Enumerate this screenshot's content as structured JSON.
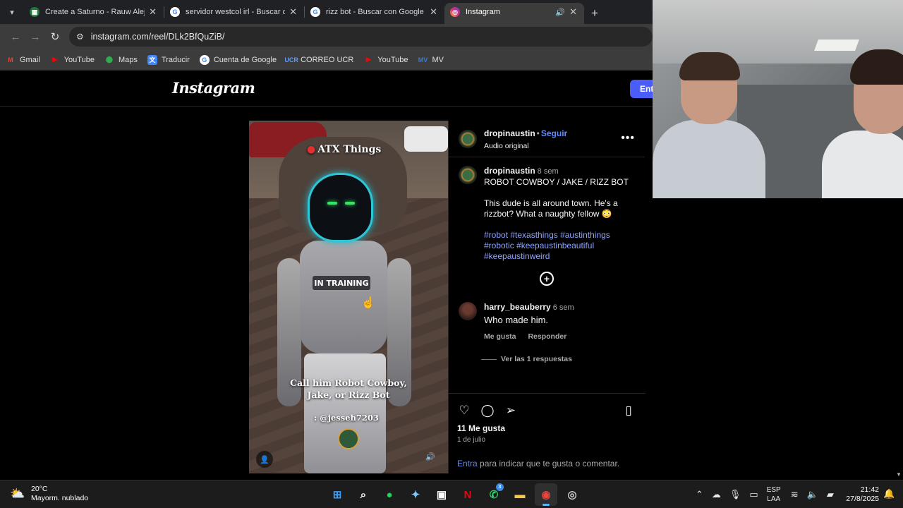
{
  "browser": {
    "tabs": [
      {
        "title": "Create a Saturno - Rauw Alejan",
        "favicon": "sheet-icon",
        "active": false
      },
      {
        "title": "servidor westcol irl - Buscar con",
        "favicon": "google-icon",
        "active": false
      },
      {
        "title": "rizz bot - Buscar con Google",
        "favicon": "google-icon",
        "active": false
      },
      {
        "title": "Instagram",
        "favicon": "instagram-icon",
        "active": true
      }
    ],
    "url": "instagram.com/reel/DLk2BfQuZiB/",
    "bookmarks": [
      {
        "label": "Gmail",
        "icon": "gmail-icon",
        "color": "#ea4335"
      },
      {
        "label": "YouTube",
        "icon": "youtube-icon",
        "color": "#ff0000"
      },
      {
        "label": "Maps",
        "icon": "maps-icon",
        "color": "#34a853"
      },
      {
        "label": "Traducir",
        "icon": "translate-icon",
        "color": "#4285f4"
      },
      {
        "label": "Cuenta de Google",
        "icon": "google-icon",
        "color": "#ffffff"
      },
      {
        "label": "CORREO UCR",
        "icon": "ucr-icon",
        "color": "#2a6fd6"
      },
      {
        "label": "YouTube",
        "icon": "youtube-icon",
        "color": "#ff0000"
      },
      {
        "label": "MV",
        "icon": "mv-icon",
        "color": "#3a7bd5"
      }
    ]
  },
  "instagram": {
    "logo": "Instagram",
    "login_button": "Entrar",
    "reel": {
      "overlay_title": "ATX Things",
      "badge": "IN TRAINING",
      "caption_line1": "Call him Robot Cowboy,",
      "caption_line2": "Jake, or Rizz Bot",
      "credit": ": @jesseh7203"
    },
    "post": {
      "username": "dropinaustin",
      "follow": "Seguir",
      "audio": "Audio original",
      "age": "8 sem",
      "description_title": "ROBOT COWBOY / JAKE / RIZZ BOT",
      "description_body": "This dude is all around town. He's a rizzbot? What a naughty fellow 😳",
      "hashtags_line1": "#robot #texasthings #austinthings",
      "hashtags_line2": "#robotic #keepaustinbeautiful",
      "hashtags_line3": "#keepaustinweird"
    },
    "comment": {
      "username": "harry_beauberry",
      "age": "6 sem",
      "text": "Who made him.",
      "like": "Me gusta",
      "reply": "Responder",
      "view_replies": "Ver las 1 respuestas"
    },
    "footer": {
      "likes": "11 Me gusta",
      "date": "1 de julio",
      "login_link": "Entra",
      "login_text": " para indicar que te gusta o comentar."
    }
  },
  "taskbar": {
    "temperature": "20°C",
    "weather": "Mayorm. nublado",
    "lang1": "ESP",
    "lang2": "LAA",
    "time": "21:42",
    "date": "27/8/2025",
    "whatsapp_badge": "3"
  },
  "colors": {
    "link_blue": "#5f8bff",
    "hashtag_blue": "#8fa4ff",
    "login_button": "#4a5df9"
  }
}
